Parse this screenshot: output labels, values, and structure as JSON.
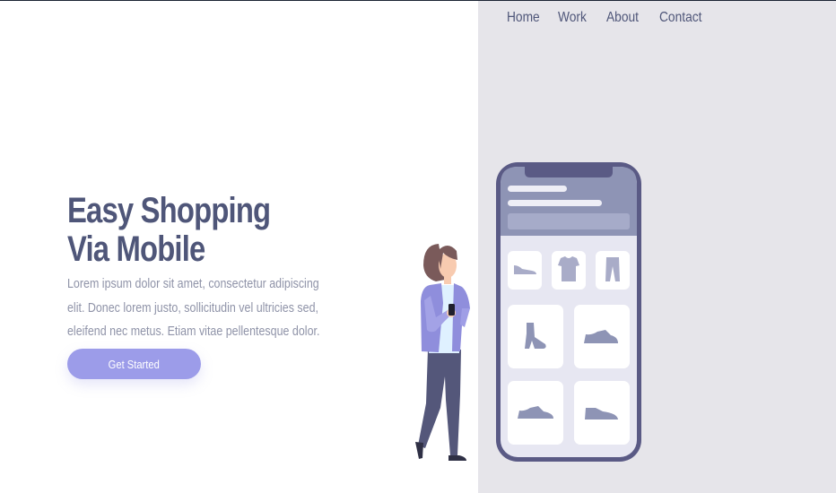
{
  "nav": {
    "items": [
      "Home",
      "Work",
      "About",
      "Contact"
    ]
  },
  "hero": {
    "title_line1": "Easy Shopping",
    "title_line2": "Via Mobile",
    "description": "Lorem ipsum dolor sit amet, consectetur adipiscing elit. Donec lorem justo, sollicitudin vel ultricies sed, eleifend nec metus. Etiam vitae pellentesque dolor.",
    "cta_label": "Get Started"
  },
  "colors": {
    "panel_bg": "#e6e5ea",
    "heading": "#4f5679",
    "body_text": "#8f93a8",
    "button": "#9c9ce9",
    "phone_frame": "#5a5a85"
  },
  "icons": {
    "phone_products": [
      "sneaker-icon",
      "tshirt-icon",
      "pants-icon",
      "boot-icon",
      "shoe-icon",
      "shoe-icon",
      "shoe-icon"
    ]
  }
}
